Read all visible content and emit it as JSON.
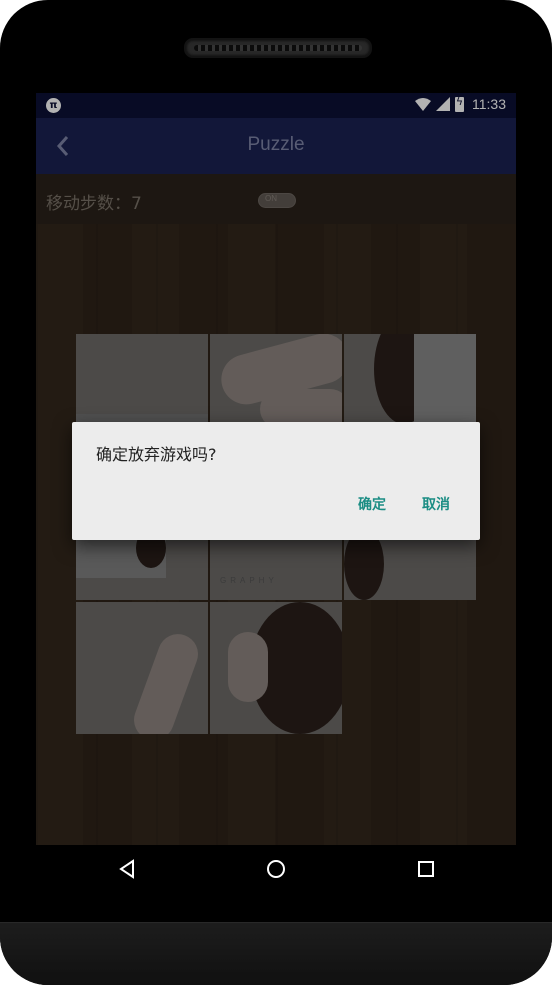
{
  "status_bar": {
    "app_icon_text": "π",
    "time": "11:33",
    "icons": [
      "wifi-icon",
      "signal-icon",
      "battery-icon"
    ]
  },
  "app_bar": {
    "title": "Puzzle",
    "back_icon": "chevron-left-icon"
  },
  "game": {
    "step_label": "移动步数：7",
    "toggle_text": "ON"
  },
  "dialog": {
    "message": "确定放弃游戏吗?",
    "confirm_label": "确定",
    "cancel_label": "取消"
  },
  "puzzle_text": "GRAPHY",
  "nav_bar": {
    "icons": [
      "back-triangle-icon",
      "home-circle-icon",
      "recents-square-icon"
    ]
  },
  "colors": {
    "status_bar": "#0c1136",
    "app_bar": "#1a2152",
    "dialog_button": "#1b8d84",
    "dialog_bg": "#ececec"
  }
}
